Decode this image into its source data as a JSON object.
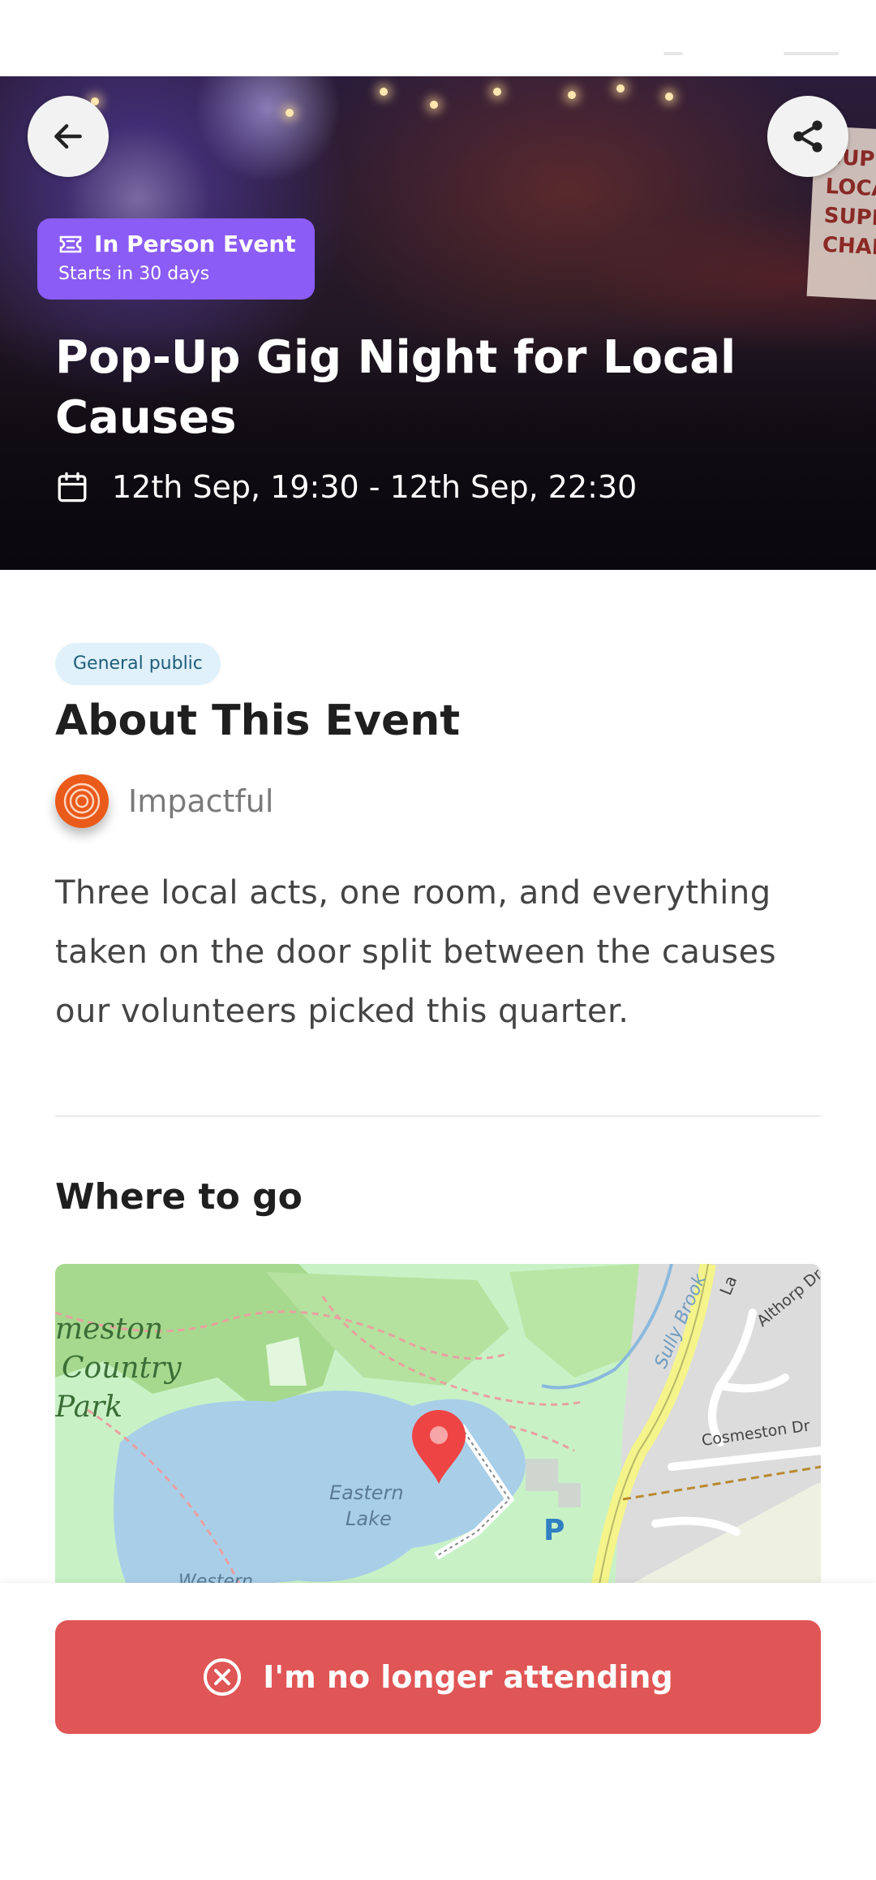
{
  "hero": {
    "badge_title": "In Person Event",
    "badge_subtitle": "Starts in 30 days",
    "title": "Pop-Up Gig Night for Local Causes",
    "dates": "12th Sep, 19:30 - 12th Sep, 22:30",
    "sign_text": "SUPPORT LOCAL SUPPORT CHANGE"
  },
  "header": {
    "back_icon": "arrow-left-icon",
    "share_icon": "share-icon"
  },
  "about": {
    "audience_label": "General public",
    "title": "About This Event",
    "organizer_name": "Impactful",
    "description": "Three local acts, one room, and everything taken on the door split between the causes our volunteers picked this quarter."
  },
  "location": {
    "title": "Where to go",
    "map_labels": {
      "park": [
        "meston",
        "Country",
        "Park"
      ],
      "lake": [
        "Eastern",
        "Lake"
      ],
      "western": "Western",
      "brook": "Sully Brook",
      "road1": "Althorp Dr",
      "road2": "Cosmeston Dr",
      "parking": "P",
      "lane": "La"
    }
  },
  "action": {
    "cancel_label": "I'm no longer attending"
  },
  "colors": {
    "accent_purple": "#8b5cf6",
    "danger_red": "#e05555",
    "pin_red": "#ef4444",
    "org_orange": "#ea5a1a"
  }
}
